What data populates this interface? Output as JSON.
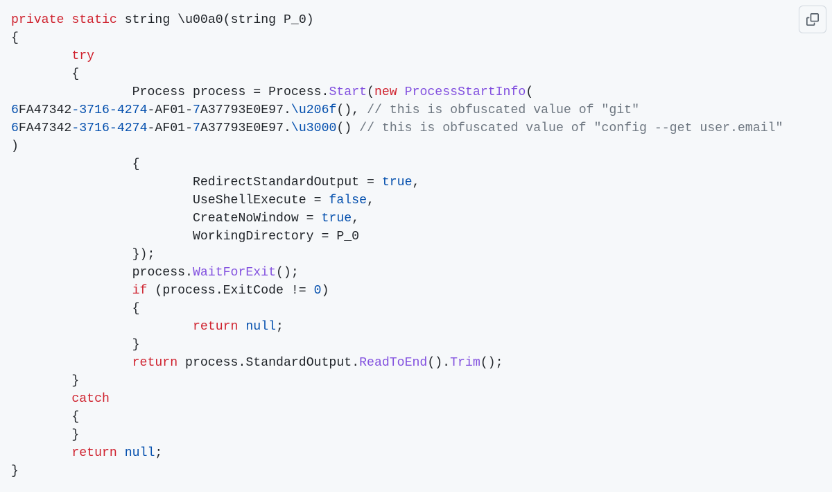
{
  "code": {
    "t_private": "private",
    "t_static": "static",
    "t_string": "string",
    "methodName": "\\u00a0",
    "paramType": "string",
    "paramName": "P_0",
    "t_try": "try",
    "t_Process": "Process",
    "t_process_var": "process",
    "t_eq": "=",
    "t_Process2": "Process",
    "t_Start": "Start",
    "t_new": "new",
    "t_ProcessStartInfo": "ProcessStartInfo",
    "guid1a": "6",
    "guid1b": "FA47342",
    "guid1c": "-",
    "guid1d": "3716",
    "guid1e": "-",
    "guid1f": "4274",
    "guid1g": "-AF01-",
    "guid1h": "7",
    "guid1i": "A37793E0E97",
    "guid1m": "\\u206f",
    "comment1": "// this is obfuscated value of \"git\"",
    "guid2a": "6",
    "guid2b": "FA47342",
    "guid2c": "-",
    "guid2d": "3716",
    "guid2e": "-",
    "guid2f": "4274",
    "guid2g": "-AF01-",
    "guid2h": "7",
    "guid2i": "A37793E0E97",
    "guid2m": "\\u3000",
    "comment2": "// this is obfuscated value of \"config --get user.email\"",
    "prop_RSO": "RedirectStandardOutput",
    "val_true1": "true",
    "prop_USE": "UseShellExecute",
    "val_false": "false",
    "prop_CNW": "CreateNoWindow",
    "val_true2": "true",
    "prop_WD": "WorkingDirectory",
    "val_P0": "P_0",
    "t_WaitForExit": "WaitForExit",
    "t_if": "if",
    "t_ExitCode": "ExitCode",
    "t_neq": "!=",
    "t_zero": "0",
    "t_return1": "return",
    "t_null1": "null",
    "t_return2": "return",
    "t_StandardOutput": "StandardOutput",
    "t_ReadToEnd": "ReadToEnd",
    "t_Trim": "Trim",
    "t_catch": "catch",
    "t_return3": "return",
    "t_null2": "null"
  },
  "ui": {
    "copy_label": "Copy"
  }
}
